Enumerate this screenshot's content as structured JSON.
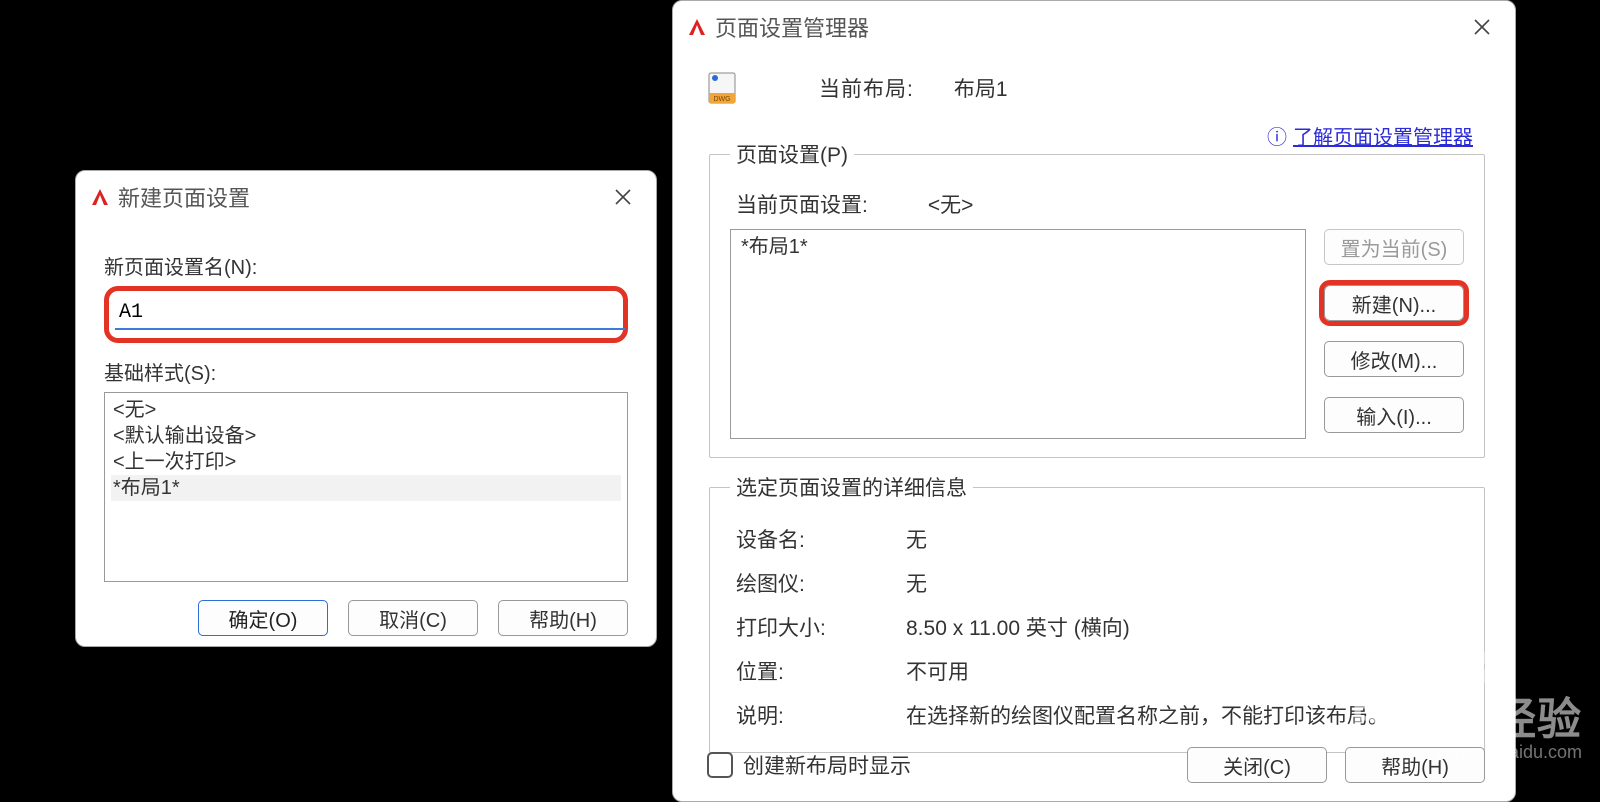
{
  "newDlg": {
    "title": "新建页面设置",
    "nameLabel": "新页面设置名(N):",
    "nameValue": "A1",
    "baseLabel": "基础样式(S):",
    "baseItems": [
      "<无>",
      "<默认输出设备>",
      "<上一次打印>",
      "*布局1*"
    ],
    "selectedBaseIndex": 3,
    "ok": "确定(O)",
    "cancel": "取消(C)",
    "help": "帮助(H)"
  },
  "mgrDlg": {
    "title": "页面设置管理器",
    "helpLink": "了解页面设置管理器",
    "currentLayoutLabel": "当前布局:",
    "currentLayoutValue": "布局1",
    "psGroupLegend": "页面设置(P)",
    "currentPsLabel": "当前页面设置:",
    "currentPsValue": "<无>",
    "psItems": [
      "*布局1*"
    ],
    "btnSetCurrent": "置为当前(S)",
    "btnNew": "新建(N)...",
    "btnModify": "修改(M)...",
    "btnImport": "输入(I)...",
    "detailLegend": "选定页面设置的详细信息",
    "details": {
      "deviceNameLabel": "设备名:",
      "deviceNameValue": "无",
      "plotterLabel": "绘图仪:",
      "plotterValue": "无",
      "sizeLabel": "打印大小:",
      "sizeValue": "8.50 x 11.00 英寸 (横向)",
      "locationLabel": "位置:",
      "locationValue": "不可用",
      "descLabel": "说明:",
      "descValue": "在选择新的绘图仪配置名称之前，不能打印该布局。"
    },
    "createOnNewLayout": "创建新布局时显示",
    "close": "关闭(C)",
    "help": "帮助(H)"
  },
  "watermark": {
    "brand": "Baidu 经验",
    "url": "jingyan.baidu.com"
  }
}
